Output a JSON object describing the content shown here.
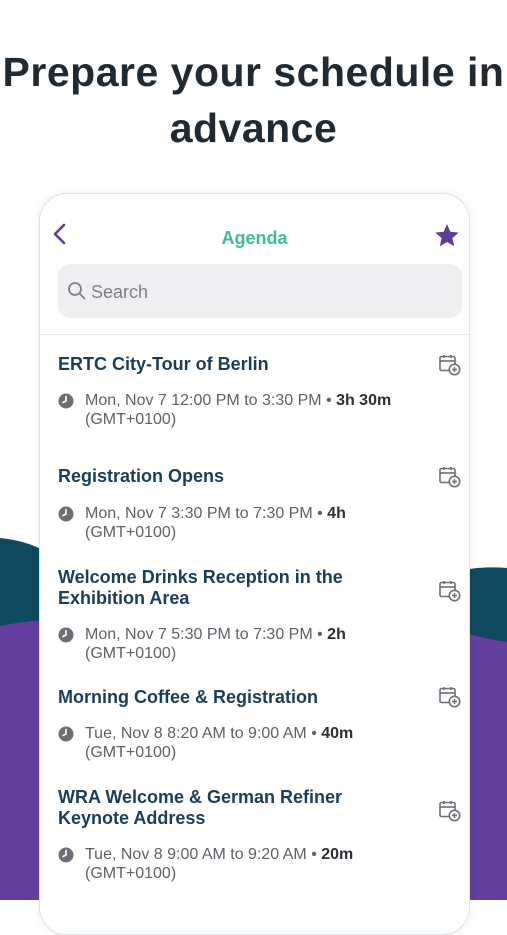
{
  "headline": "Prepare your schedule in advance",
  "colors": {
    "accent_green": "#3dbb99",
    "accent_purple": "#5f3d9a",
    "bg_teal": "#0f4a5f",
    "bg_purple": "#643f9e",
    "title_navy": "#1b3d55"
  },
  "nav": {
    "title": "Agenda",
    "back_icon": "chevron-left-icon",
    "favorite_icon": "star-icon"
  },
  "search": {
    "placeholder": "Search",
    "value": ""
  },
  "sessions": [
    {
      "title": "ERTC City-Tour of Berlin",
      "time": "Mon, Nov 7 12:00 PM to 3:30 PM",
      "duration": "3h 30m",
      "tz": "(GMT+0100)"
    },
    {
      "title": "Registration Opens",
      "time": "Mon, Nov 7 3:30 PM to 7:30 PM",
      "duration": "4h",
      "tz": "(GMT+0100)"
    },
    {
      "title": "Welcome Drinks Reception in the Exhibition Area",
      "time": "Mon, Nov 7 5:30 PM to 7:30 PM",
      "duration": "2h",
      "tz": "(GMT+0100)"
    },
    {
      "title": "Morning Coffee & Registration",
      "time": "Tue, Nov 8 8:20 AM to 9:00 AM",
      "duration": "40m",
      "tz": "(GMT+0100)"
    },
    {
      "title": "WRA Welcome & German Refiner Keynote Address",
      "time": "Tue, Nov 8 9:00 AM to 9:20 AM",
      "duration": "20m",
      "tz": "(GMT+0100)"
    }
  ]
}
